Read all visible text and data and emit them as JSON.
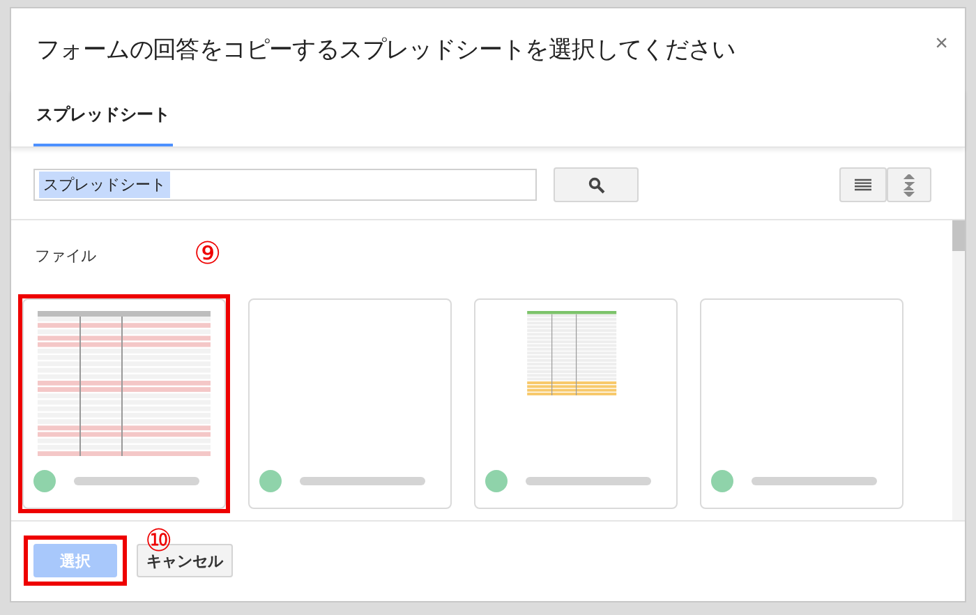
{
  "dialog": {
    "title": "フォームの回答をコピーするスプレッドシートを選択してください",
    "close": "×"
  },
  "tabs": [
    {
      "label": "スプレッドシート",
      "selected": true
    }
  ],
  "search": {
    "value": "スプレッドシート"
  },
  "section": {
    "label": "ファイル",
    "annotation": "⑨"
  },
  "files": [
    {
      "kind": "pink-table",
      "highlighted": true
    },
    {
      "kind": "blank",
      "highlighted": false
    },
    {
      "kind": "green-table",
      "highlighted": false
    },
    {
      "kind": "blank",
      "highlighted": false
    }
  ],
  "footer": {
    "annotation": "⑩"
  },
  "buttons": [
    {
      "label": "選択",
      "kind": "primary",
      "disabled": true,
      "highlighted": true
    },
    {
      "label": "キャンセル",
      "kind": "secondary",
      "disabled": false,
      "highlighted": false
    }
  ]
}
